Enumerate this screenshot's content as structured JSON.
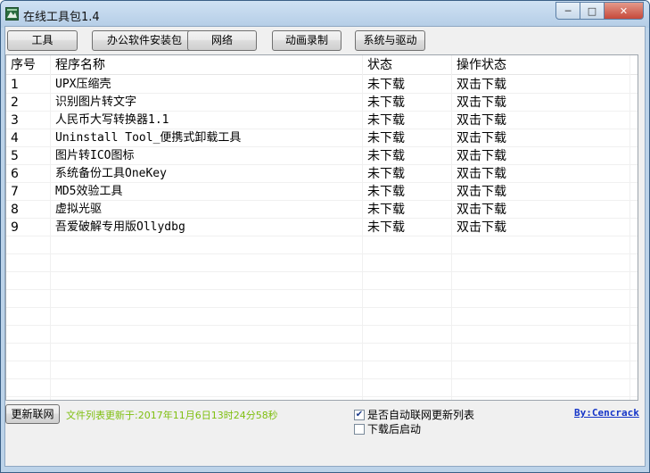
{
  "window": {
    "title": "在线工具包1.4",
    "controls": {
      "minimize": "─",
      "maximize": "□",
      "close": "✕"
    }
  },
  "toolbar": [
    {
      "label": "工具"
    },
    {
      "label": "办公软件安装包"
    },
    {
      "label": "网络"
    },
    {
      "label": "动画录制"
    },
    {
      "label": "系统与驱动"
    }
  ],
  "list": {
    "columns": [
      "序号",
      "程序名称",
      "状态",
      "操作状态"
    ],
    "rows": [
      {
        "index": "1",
        "name": "UPX压缩壳",
        "status": "未下载",
        "action": "双击下载"
      },
      {
        "index": "2",
        "name": "识别图片转文字",
        "status": "未下载",
        "action": "双击下载"
      },
      {
        "index": "3",
        "name": "人民币大写转换器1.1",
        "status": "未下载",
        "action": "双击下载"
      },
      {
        "index": "4",
        "name": "Uninstall Tool_便携式卸载工具",
        "status": "未下载",
        "action": "双击下载"
      },
      {
        "index": "5",
        "name": "图片转ICO图标",
        "status": "未下载",
        "action": "双击下载"
      },
      {
        "index": "6",
        "name": "系统备份工具OneKey",
        "status": "未下载",
        "action": "双击下载"
      },
      {
        "index": "7",
        "name": "MD5效验工具",
        "status": "未下载",
        "action": "双击下载"
      },
      {
        "index": "8",
        "name": "虚拟光驱",
        "status": "未下载",
        "action": "双击下载"
      },
      {
        "index": "9",
        "name": "吾爱破解专用版Ollydbg",
        "status": "未下载",
        "action": "双击下载"
      }
    ]
  },
  "footer": {
    "refresh_label": "更新联网",
    "update_status": "文件列表更新于:2017年11月6日13时24分58秒",
    "auto_update": {
      "label": "是否自动联网更新列表",
      "checked": true
    },
    "launch_after": {
      "label": "下载后启动",
      "checked": false
    },
    "author": "By:Cencrack"
  },
  "colors": {
    "status_text": "#7fbf10",
    "link": "#1535c8",
    "titlebar": "#bcd3e9"
  }
}
